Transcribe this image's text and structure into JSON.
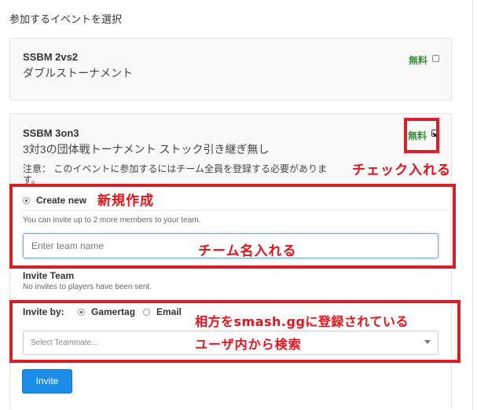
{
  "section_title": "参加するイベントを選択",
  "events": [
    {
      "name": "SSBM 2vs2",
      "subtitle": "ダブルストーナメント",
      "price_label": "無料",
      "checked": false
    },
    {
      "name": "SSBM 3on3",
      "subtitle": "3対3の団体戦トーナメント ストック引き継ぎ無し",
      "price_label": "無料",
      "checked": true,
      "note_line1": "注意： このイベントに参加するにはチーム全員を登録する必要がありま",
      "note_line2": "す。"
    }
  ],
  "team": {
    "create_new_label": "Create new",
    "invite_hint": "You can invite up to 2 more members to your team.",
    "team_name_placeholder": "Enter team name",
    "invite_team_title": "Invite Team",
    "invite_status": "No invites to players have been sent.",
    "invite_by_label": "Invite by:",
    "option_gamertag": "Gamertag",
    "option_email": "Email",
    "select_placeholder": "Select Teammate...",
    "invite_button": "Invite"
  },
  "annotations": {
    "check": "チェック入れる",
    "create_new": "新規作成",
    "team_name": "チーム名入れる",
    "search_line1": "相方をsmash.ggに登録されている",
    "search_line2": "ユーザ内から検索"
  },
  "colors": {
    "annotation_red": "#d9202a",
    "free_green": "#3c8d3c",
    "button_blue": "#1a8de8"
  }
}
